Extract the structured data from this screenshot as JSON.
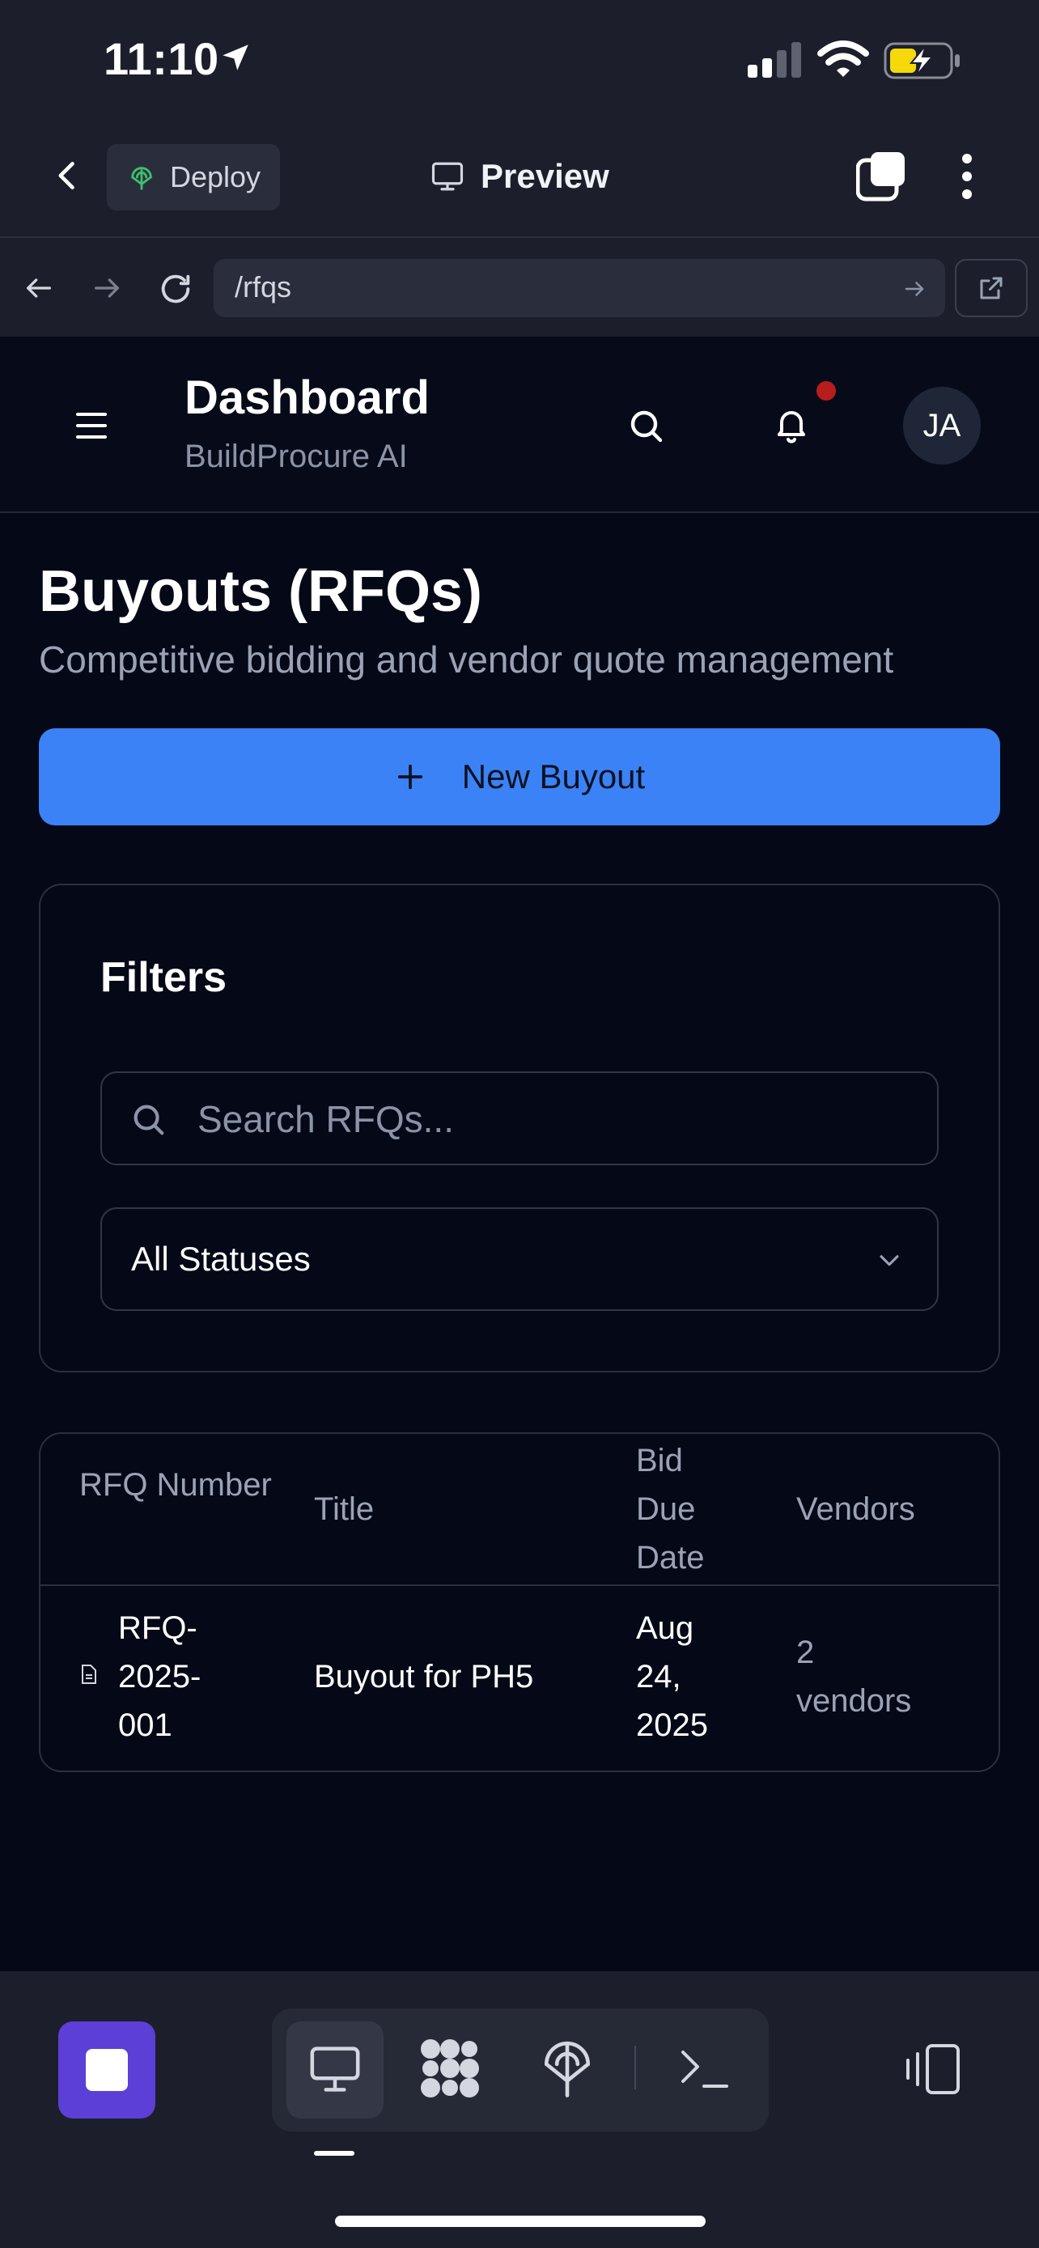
{
  "status_bar": {
    "time": "11:10"
  },
  "app_bar": {
    "deploy_label": "Deploy",
    "preview_label": "Preview"
  },
  "url_bar": {
    "path": "/rfqs"
  },
  "header": {
    "title": "Dashboard",
    "subtitle": "BuildProcure AI",
    "avatar_initials": "JA",
    "has_notification": true
  },
  "page": {
    "title": "Buyouts (RFQs)",
    "subtitle": "Competitive bidding and vendor quote management",
    "new_button_label": "New Buyout"
  },
  "filters": {
    "title": "Filters",
    "search_placeholder": "Search RFQs...",
    "status_selected": "All Statuses"
  },
  "table": {
    "columns": [
      "RFQ Number",
      "Title",
      "Bid Due Date",
      "Vendors"
    ],
    "rows": [
      {
        "rfq_number": "RFQ-2025-001",
        "title": "Buyout for PH5",
        "bid_due_date": "Aug 24, 2025",
        "vendors": "2 vendors"
      }
    ]
  },
  "colors": {
    "primary": "#3b82f6",
    "stop_button": "#5b3fd6",
    "notification": "#b91c1c",
    "background": "#050816"
  },
  "icons": [
    "location-arrow-icon",
    "signal-icon",
    "wifi-icon",
    "battery-charging-icon",
    "back-chevron-icon",
    "deploy-icon",
    "monitor-icon",
    "tabs-icon",
    "more-vertical-icon",
    "arrow-left-icon",
    "arrow-right-icon",
    "refresh-icon",
    "go-arrow-icon",
    "external-link-icon",
    "menu-icon",
    "search-icon",
    "bell-icon",
    "plus-icon",
    "chevron-down-icon",
    "file-icon",
    "stop-icon",
    "preview-tab-icon",
    "workspace-tab-icon",
    "deployments-tab-icon",
    "shell-tab-icon",
    "layout-toggle-icon"
  ]
}
